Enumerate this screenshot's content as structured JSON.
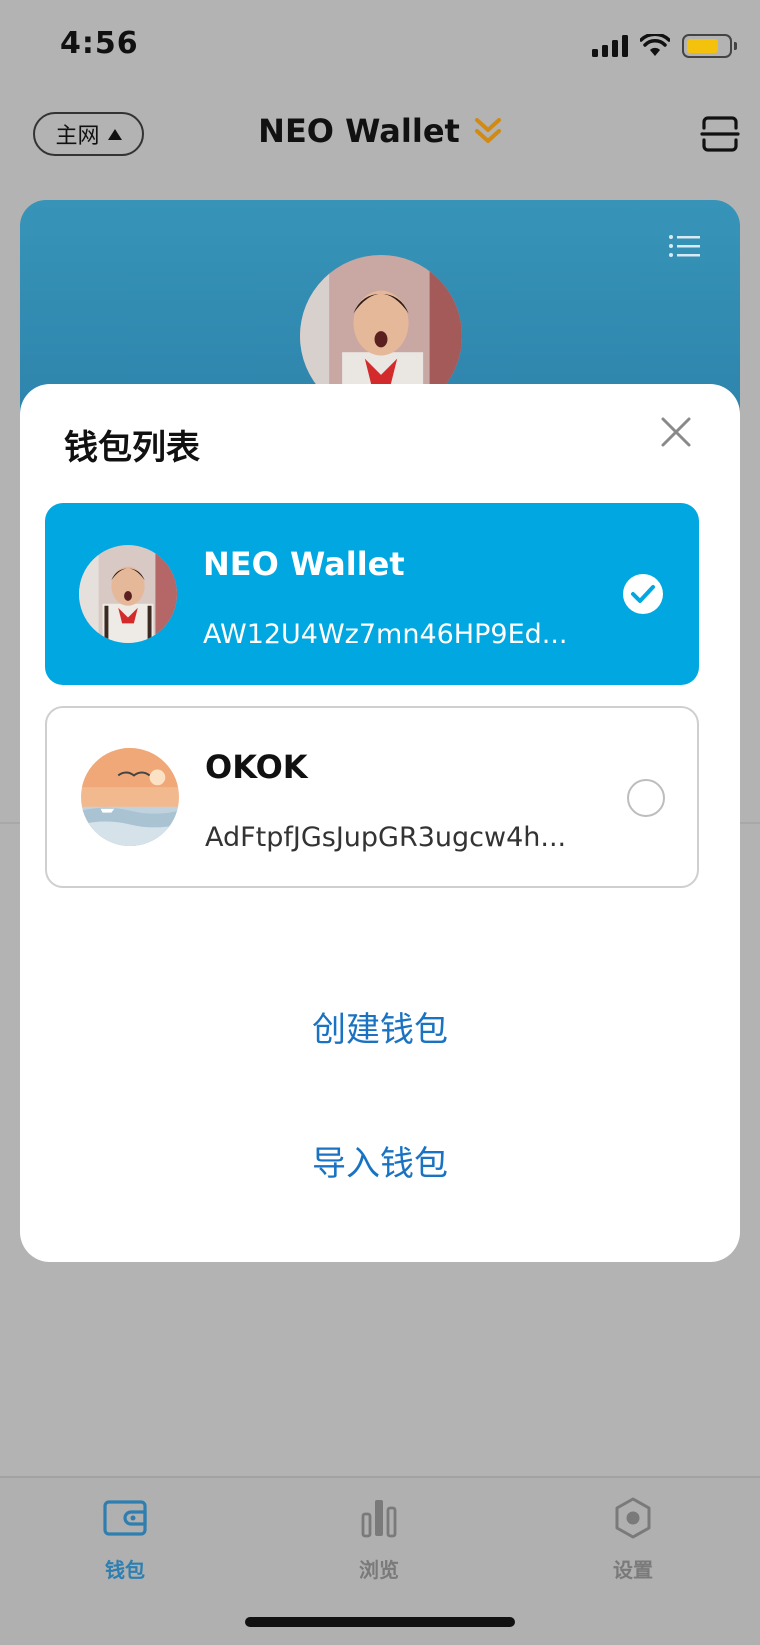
{
  "status_bar": {
    "time": "4:56",
    "battery_color": "#f4c20d"
  },
  "nav": {
    "network_label": "主网",
    "title": "NEO Wallet",
    "title_chevron_color": "#d18a12"
  },
  "card": {
    "background": "#3794b8",
    "menu_icon": "list-icon"
  },
  "sheet": {
    "title": "钱包列表",
    "wallets": [
      {
        "name": "NEO Wallet",
        "address": "AW12U4Wz7mn46HP9Ed...",
        "selected": true
      },
      {
        "name": "OKOK",
        "address": "AdFtpfJGsJupGR3ugcw4h...",
        "selected": false
      }
    ],
    "create_label": "创建钱包",
    "import_label": "导入钱包",
    "accent_color": "#00a7e1",
    "link_color": "#1a73c2"
  },
  "tabs": [
    {
      "label": "钱包",
      "icon": "wallet-icon",
      "active": true
    },
    {
      "label": "浏览",
      "icon": "bar-chart-icon",
      "active": false
    },
    {
      "label": "设置",
      "icon": "gear-icon",
      "active": false
    }
  ]
}
